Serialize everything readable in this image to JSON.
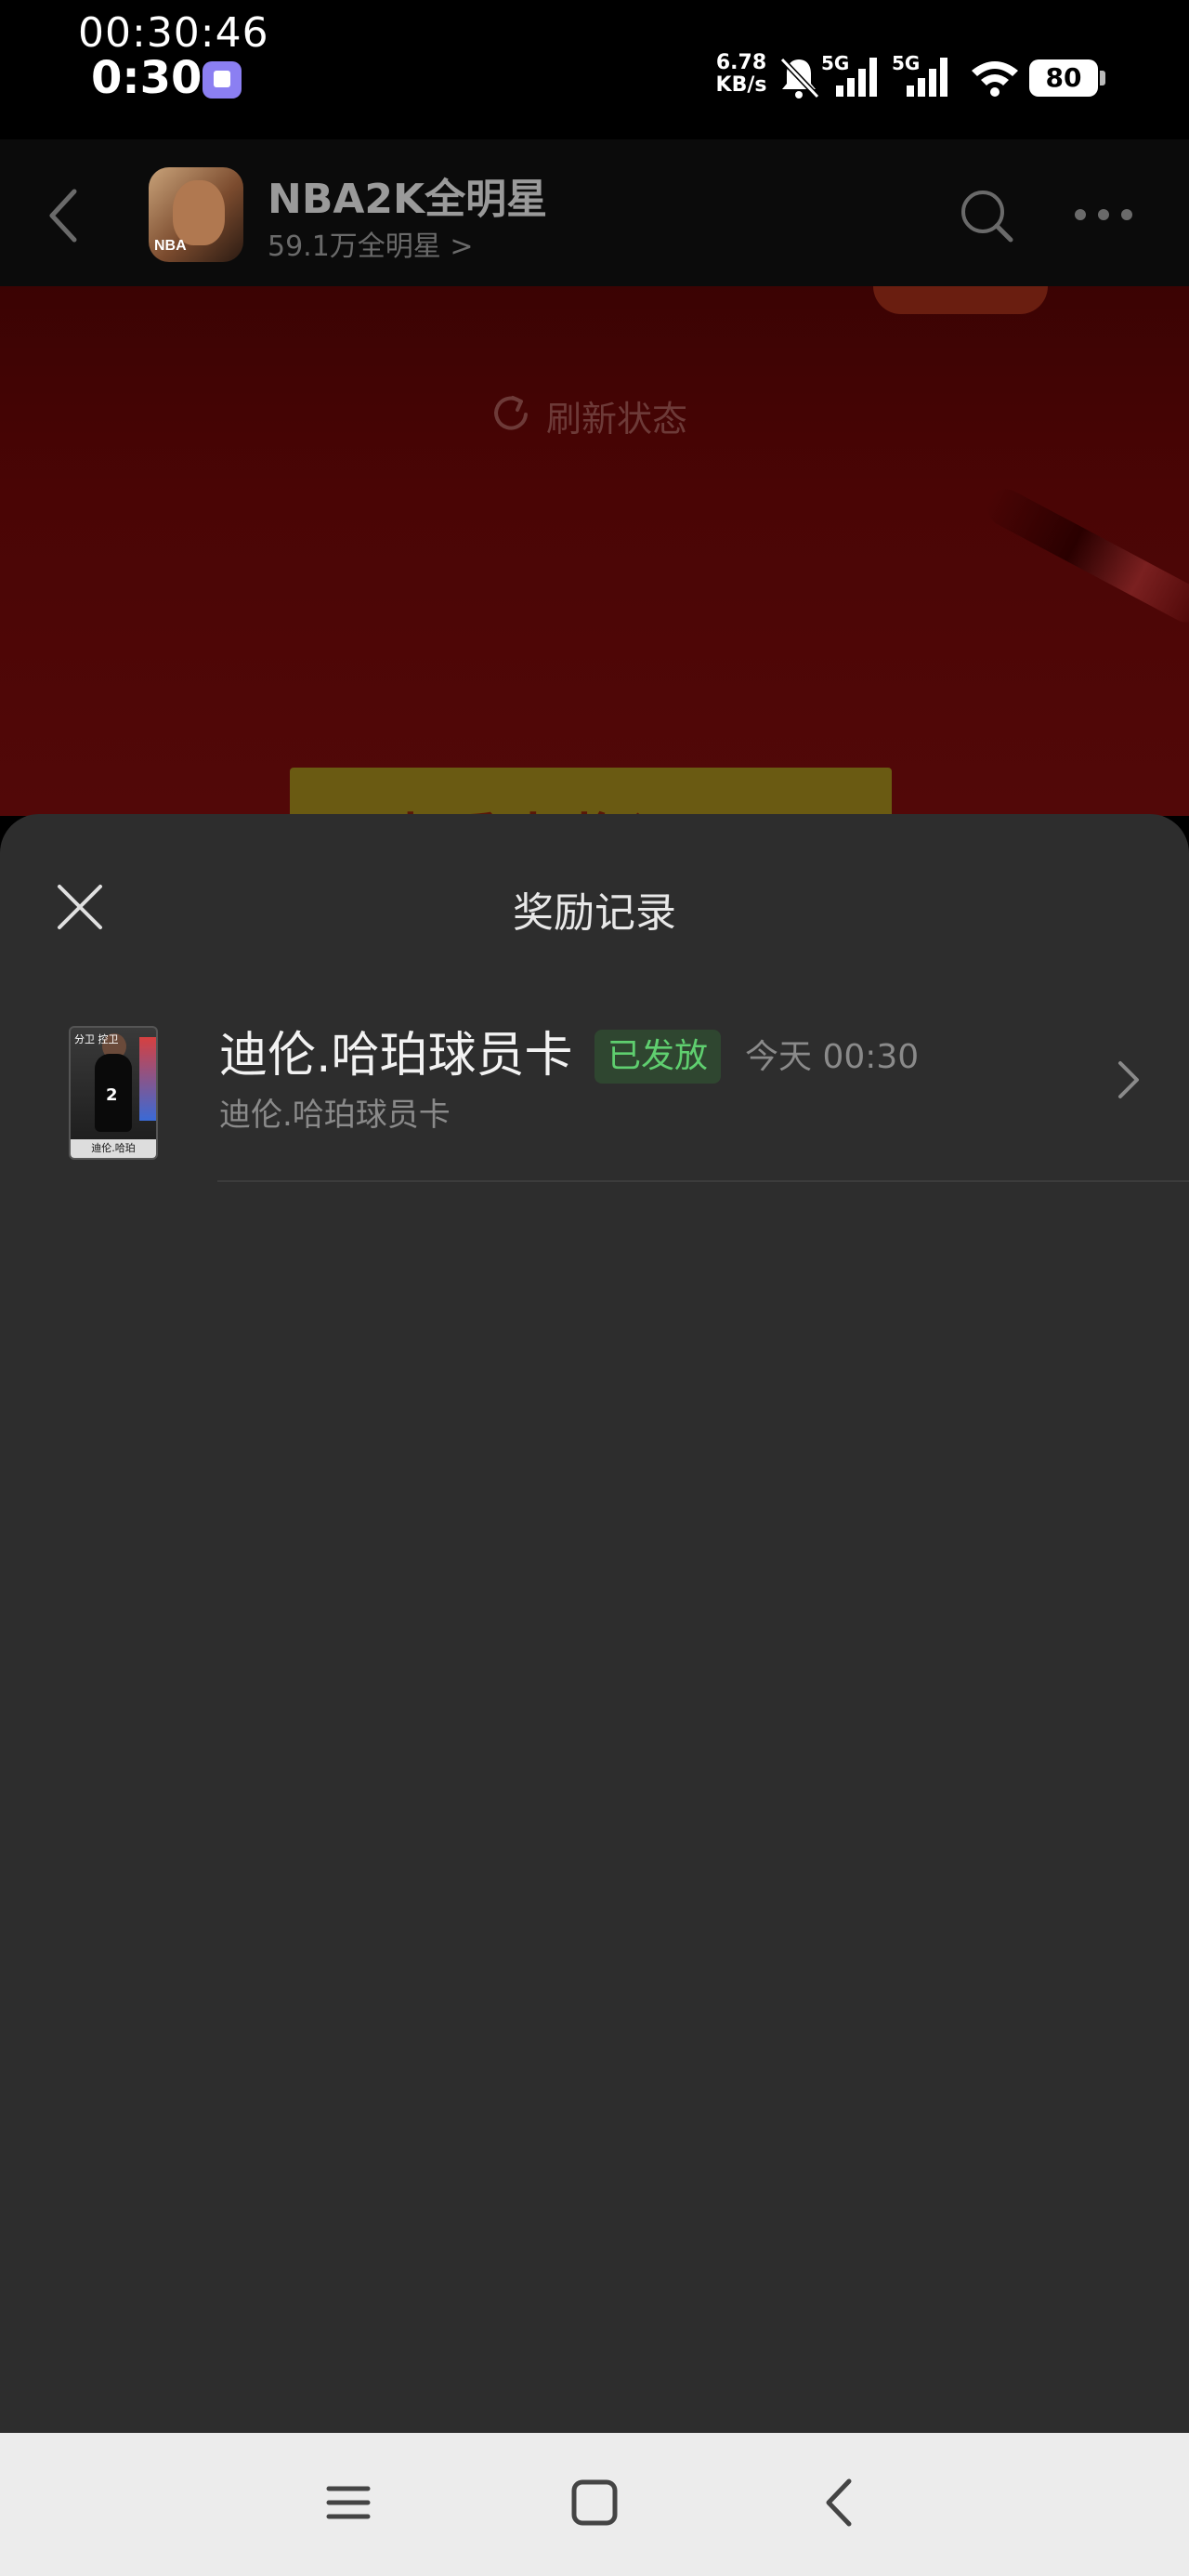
{
  "status_bar": {
    "time_seconds": "00:30:46",
    "time": "0:30",
    "net_speed_value": "6.78",
    "net_speed_unit": "KB/s",
    "signal_1": "5G",
    "signal_2": "5G",
    "battery": "80"
  },
  "header": {
    "game_name": "NBA2K全明星",
    "followers": "59.1万全明星 >",
    "avatar_text": "NBA"
  },
  "background_page": {
    "refresh_label": "刷新状态",
    "banner_text": "查看中奖记录"
  },
  "sheet": {
    "title": "奖励记录",
    "records": [
      {
        "title": "迪伦.哈珀球员卡",
        "badge": "已发放",
        "time": "今天 00:30",
        "subtitle": "迪伦.哈珀球员卡",
        "card_name": "迪伦.哈珀",
        "card_position": "分卫 控卫",
        "card_number": "2"
      }
    ]
  },
  "colors": {
    "sheet_bg": "#2d2d2d",
    "badge_bg": "#2f4630",
    "badge_text": "#5fcf6f",
    "page_red": "#4a0505"
  }
}
